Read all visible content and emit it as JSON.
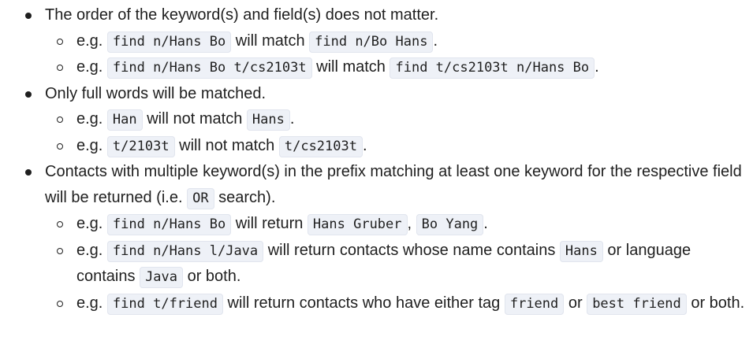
{
  "items": [
    {
      "text": "The order of the keyword(s) and field(s) does not matter.",
      "subitems": [
        {
          "t1": "e.g.",
          "c1": "find n/Hans Bo",
          "t2": "will match",
          "c2": "find n/Bo Hans",
          "t3": "."
        },
        {
          "t1": "e.g.",
          "c1": "find n/Hans Bo t/cs2103t",
          "t2": "will match",
          "c2": "find t/cs2103t n/Hans Bo",
          "t3": "."
        }
      ]
    },
    {
      "text": "Only full words will be matched.",
      "subitems": [
        {
          "t1": "e.g.",
          "c1": "Han",
          "t2": "will not match",
          "c2": "Hans",
          "t3": "."
        },
        {
          "t1": "e.g.",
          "c1": "t/2103t",
          "t2": "will not match",
          "c2": "t/cs2103t",
          "t3": "."
        }
      ]
    },
    {
      "text_a": "Contacts with multiple keyword(s) in the prefix matching at least one keyword for the respective field will be returned (i.e.",
      "code": "OR",
      "text_b": "search).",
      "subitems": [
        {
          "t1": "e.g.",
          "c1": "find n/Hans Bo",
          "t2": "will return",
          "c2": "Hans Gruber",
          "t3": ",",
          "c3": "Bo Yang",
          "t4": "."
        },
        {
          "t1": "e.g.",
          "c1": "find n/Hans l/Java",
          "t2": "will return contacts whose name contains",
          "c2": "Hans",
          "t3": "or language contains",
          "c3": "Java",
          "t4": "or both."
        },
        {
          "t1": "e.g.",
          "c1": "find t/friend",
          "t2": "will return contacts who have either tag",
          "c2": "friend",
          "t3": "or",
          "c3": "best friend",
          "t4": "or both."
        }
      ]
    }
  ]
}
